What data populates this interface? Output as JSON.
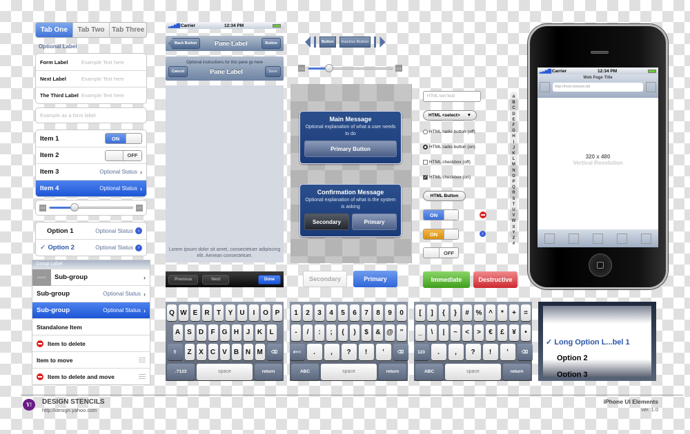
{
  "tabs": [
    "Tab One",
    "Tab Two",
    "Tab Three"
  ],
  "optional_label": "Optional Label",
  "form": [
    {
      "label": "Form Label",
      "placeholder": "Example Text here"
    },
    {
      "label": "Next Label",
      "placeholder": "Example Text here"
    },
    {
      "label": "The Third Label",
      "placeholder": "Example Text here"
    }
  ],
  "single_field_placeholder": "Example as a form label",
  "items": [
    {
      "label": "Item 1",
      "toggle": "ON"
    },
    {
      "label": "Item 2",
      "toggle": "OFF"
    },
    {
      "label": "Item 3",
      "status": "Optional Status"
    },
    {
      "label": "Item 4",
      "status": "Optional Status",
      "selected": true
    }
  ],
  "slider": {
    "min_icon": "ICN",
    "max_icon": "ICN",
    "value": 0.3
  },
  "options": [
    {
      "label": "Option 1",
      "status": "Optional Status"
    },
    {
      "label": "Option 2",
      "status": "Optional Status",
      "checked": true,
      "check": "✓"
    }
  ],
  "group": {
    "label": "Group Label",
    "image": "IMAGE",
    "rows": [
      "Sub-group",
      "Sub-group",
      "Sub-group",
      "Standalone Item",
      "Item to delete",
      "Item to move",
      "Item to delete and move"
    ],
    "status": "Optional Status"
  },
  "statusbar": {
    "carrier": "Carrier",
    "time": "12:34 PM"
  },
  "navbar1": {
    "back": "Back Button",
    "title": "Pane Label",
    "button": "Button"
  },
  "navbar2": {
    "prompt": "Optional instructions for this pane go here",
    "cancel": "Cancel",
    "title": "Pane Label",
    "save": "Save"
  },
  "lorem": "Lorem ipsum dolor sit amet, consectetuer adipiscing elit. Aenean consectetuer.",
  "toolbar": {
    "previous": "Previous",
    "next": "Next",
    "done": "Done"
  },
  "segbuttons": {
    "button": "Button",
    "inactive": "Inactive Button"
  },
  "slider2": {
    "min_icon": "ICN",
    "max_icon": "ICN",
    "value": 0.25
  },
  "alert1": {
    "title": "Main Message",
    "text": "Optional explanation of what a user needs to do",
    "button": "Primary Button"
  },
  "alert2": {
    "title": "Confirmation Message",
    "text": "Optional explanation of what is the system is asking",
    "secondary": "Secondary",
    "primary": "Primary"
  },
  "buttons": {
    "secondary": "Secondary",
    "primary": "Primary",
    "immediate": "Immediate",
    "destructive": "Destructive"
  },
  "html": {
    "textfield": "HTML text field",
    "select": "HTML <select>",
    "radio_off": "HTML radio button (off)",
    "radio_on": "HTML radio button (on)",
    "cb_off": "HTML checkbox (off)",
    "cb_on": "HTML checkbox (on)",
    "button": "HTML Button"
  },
  "toggles": [
    {
      "label": "ON",
      "color": "#3b6ed8"
    },
    {
      "label": "ON",
      "color": "#d9900d"
    },
    {
      "label": "OFF"
    }
  ],
  "index": [
    "A",
    "B",
    "C",
    "D",
    "E",
    "F",
    "G",
    "H",
    "I",
    "J",
    "K",
    "L",
    "M",
    "N",
    "O",
    "P",
    "Q",
    "R",
    "S",
    "T",
    "U",
    "V",
    "W",
    "X",
    "Y",
    "Z",
    "#"
  ],
  "phone": {
    "carrier": "Carrier",
    "time": "12:34 PM",
    "page_title": "Web Page Title",
    "url": "http://host.domain.tld",
    "resolution": "320 x 480",
    "resolution_label": "Vertical Resolution"
  },
  "keyboards": [
    [
      [
        "Q",
        "W",
        "E",
        "R",
        "T",
        "Y",
        "U",
        "I",
        "O",
        "P"
      ],
      [
        "A",
        "S",
        "D",
        "F",
        "G",
        "H",
        "J",
        "K",
        "L"
      ],
      [
        "⇧",
        "Z",
        "X",
        "C",
        "V",
        "B",
        "N",
        "M",
        "⌫"
      ],
      [
        ".?123",
        "space",
        "return"
      ]
    ],
    [
      [
        "1",
        "2",
        "3",
        "4",
        "5",
        "6",
        "7",
        "8",
        "9",
        "0"
      ],
      [
        "-",
        "/",
        ":",
        ";",
        "(",
        ")",
        "$",
        "&",
        "@",
        "”"
      ],
      [
        "#+=",
        ".",
        ",",
        "?",
        "!",
        "’",
        "⌫"
      ],
      [
        "ABC",
        "space",
        "return"
      ]
    ],
    [
      [
        "[",
        "]",
        "{",
        "}",
        "#",
        "%",
        "^",
        "*",
        "+",
        "="
      ],
      [
        "_",
        "\\",
        "|",
        "~",
        "<",
        ">",
        "€",
        "£",
        "¥",
        "•"
      ],
      [
        "123",
        ".",
        ",",
        "?",
        "!",
        "’",
        "⌫"
      ],
      [
        "ABC",
        "space",
        "return"
      ]
    ]
  ],
  "picker": {
    "options": [
      "Long Option L...bel 1",
      "Option 2",
      "Option 3"
    ],
    "check": "✓"
  },
  "footer": {
    "brand": "DESIGN STENCILS",
    "url": "http://design.yahoo.com",
    "title": "iPhone UI Elements",
    "version": "ver. 1.0",
    "logo": "Y!"
  },
  "colors": {
    "accent": "#3f73d9",
    "alert": "#1f4282",
    "immediate": "#4fae25",
    "destructive": "#d8353a",
    "logo": "#6a1b86"
  }
}
